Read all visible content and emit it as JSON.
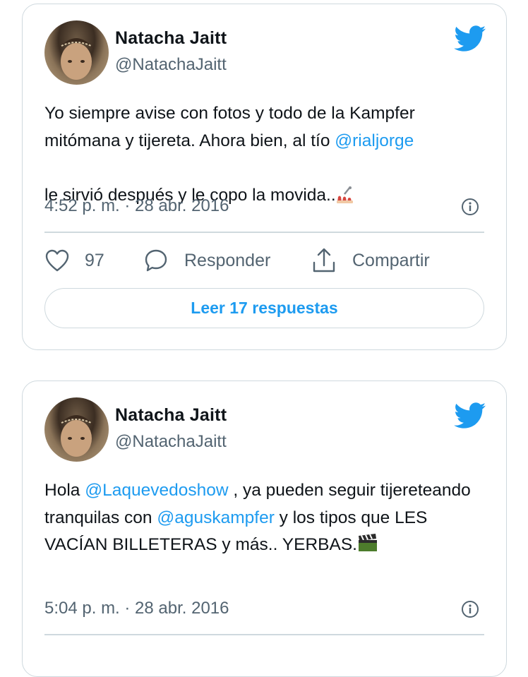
{
  "colors": {
    "accent": "#1d9bf0",
    "muted": "#536471",
    "border": "#cfd9de",
    "text": "#0f1419"
  },
  "tweets": [
    {
      "name": "Natacha Jaitt",
      "handle": "@NatachaJaitt",
      "text_parts": [
        "Yo siempre avise con fotos y todo de la Kampfer mitómana y tijereta. Ahora bien, al tío ",
        "@rialjorge",
        "\nle sirvió después y le copo la movida.."
      ],
      "emoji": "nail-polish-emoji",
      "timestamp": "4:52 p. m. · 28 abr. 2016",
      "likes": "97",
      "reply_label": "Responder",
      "share_label": "Compartir",
      "read_replies_label": "Leer 17 respuestas"
    },
    {
      "name": "Natacha Jaitt",
      "handle": "@NatachaJaitt",
      "text_parts": [
        "Hola ",
        "@Laquevedoshow",
        " , ya pueden seguir tijereteando tranquilas con ",
        "@aguskampfer",
        " y los tipos que LES VACÍAN BILLETERAS y más.. YERBAS."
      ],
      "emoji": "clapper-board-emoji",
      "timestamp": "5:04 p. m. · 28 abr. 2016"
    }
  ]
}
